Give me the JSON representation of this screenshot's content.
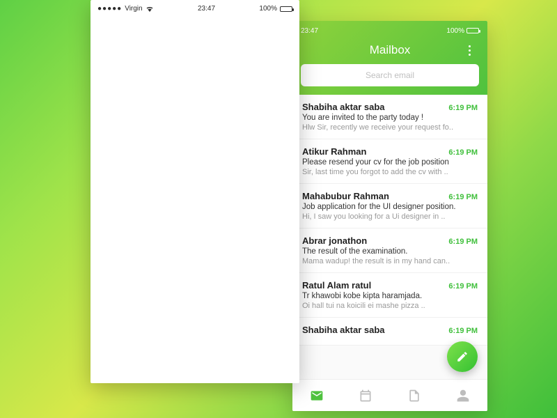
{
  "statusbar": {
    "carrier": "Virgin",
    "time": "23:47",
    "battery": "100%"
  },
  "right_statusbar": {
    "time": "23:47",
    "battery": "100%"
  },
  "header": {
    "title": "Mailbox"
  },
  "search": {
    "placeholder": "Search email"
  },
  "emails": [
    {
      "sender": "Shabiha aktar saba",
      "time": "6:19 PM",
      "subject": "You are invited to the party today !",
      "preview": "Hlw Sir, recently we receive your request fo.."
    },
    {
      "sender": "Atikur Rahman",
      "time": "6:19 PM",
      "subject": "Please resend your cv for the job position",
      "preview": "Sir, last time you forgot to add the cv with .."
    },
    {
      "sender": "Mahabubur Rahman",
      "time": "6:19 PM",
      "subject": "Job application for the UI designer position.",
      "preview": "Hi, I saw you looking for a Ui designer in .."
    },
    {
      "sender": "Abrar jonathon",
      "time": "6:19 PM",
      "subject": "The result of the examination.",
      "preview": "Mama wadup! the result is in my hand can.."
    },
    {
      "sender": "Ratul Alam ratul",
      "time": "6:19 PM",
      "subject": "Tr khawobi kobe kipta haramjada.",
      "preview": "Oi hall tui na koicili ei mashe pizza .."
    },
    {
      "sender": "Shabiha aktar saba",
      "time": "6:19 PM",
      "subject": "",
      "preview": ""
    }
  ]
}
